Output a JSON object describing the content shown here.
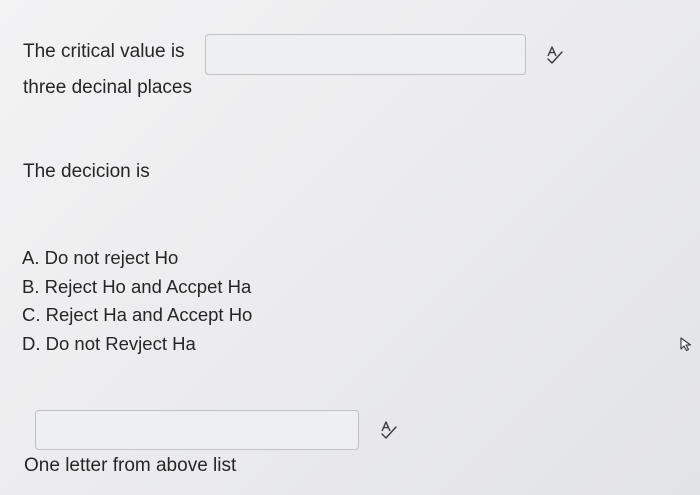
{
  "question1": {
    "label": "The critical value is",
    "answer_value": "",
    "hint": "three decinal places",
    "spellcheck_icon": "spellcheck-icon"
  },
  "question2": {
    "label": "The decicion is",
    "options": [
      "A. Do not reject Ho",
      "B. Reject Ho and Accpet Ha",
      "C. Reject Ha and Accept Ho",
      "D. Do not Revject Ha"
    ],
    "answer_value": "",
    "hint": "One letter from above list",
    "spellcheck_icon": "spellcheck-icon"
  },
  "cursor_icon": "mouse-pointer-icon"
}
